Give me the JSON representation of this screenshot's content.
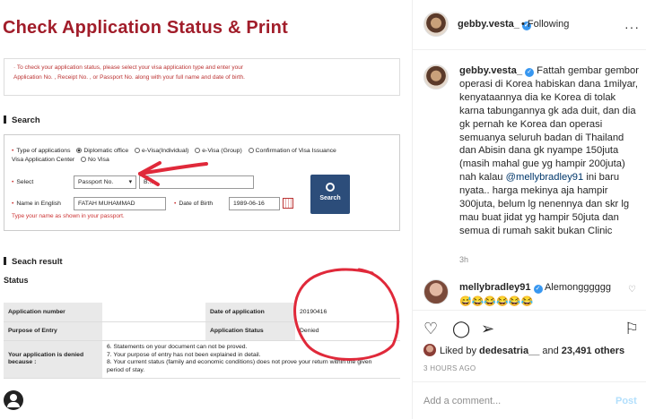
{
  "form": {
    "title": "Check Application Status & Print",
    "instructions": [
      "· To check your application status, please select your visa application type and enter your",
      "Application No. , Receipt No. , or Passport No. along with your full name and date of birth."
    ],
    "search_heading": "Search",
    "type_label": "Type of applications",
    "application_types": [
      {
        "label": "Diplomatic office",
        "selected": true
      },
      {
        "label": "e-Visa(Individual)",
        "selected": false
      },
      {
        "label": "e-Visa (Group)",
        "selected": false
      },
      {
        "label": "Confirmation of Visa Issuance",
        "selected": false
      },
      {
        "label": "Visa Application Center",
        "selected": false
      },
      {
        "label": "No Visa",
        "selected": false
      }
    ],
    "select_label": "Select",
    "select_value": "Passport No.",
    "passport_value": "B...",
    "name_label": "Name in English",
    "name_value": "FATAH MUHAMMAD",
    "dob_label": "Date of Birth",
    "dob_value": "1989-06-16",
    "search_button": "Search",
    "name_hint": "Type your name as shown in your passport.",
    "result_heading": "Seach result",
    "status_label": "Status",
    "rows": {
      "app_number_label": "Application number",
      "date_label": "Date of application",
      "date_value": "20190416",
      "purpose_label": "Purpose of Entry",
      "status_col_label": "Application Status",
      "status_value": "Denied",
      "denied_label": "Your application is denied because :",
      "reasons": [
        "6. Statements on your document can not be proved.",
        "7. Your purpose of entry has not been explained in detail.",
        "8. Your current status (family and economic conditions) does not prove your return within the given",
        "period of stay."
      ]
    }
  },
  "instagram": {
    "author": "gebby.vesta_",
    "following": "Following",
    "caption_user": "gebby.vesta_",
    "caption_text_1": "Fattah gembar gembor operasi di Korea habiskan dana 1milyar, kenyataannya dia ke Korea di tolak karna tabungannya gk ada duit, dan dia gk pernah ke Korea dan operasi semuanya seluruh badan di Thailand dan Abisin dana gk nyampe 150juta (masih mahal gue yg hampir 200juta) nah kalau",
    "caption_mention": "@mellybradley91",
    "caption_text_2": "ini baru nyata.. harga mekinya aja hampir 300juta, belum lg nenennya dan skr lg mau buat jidat yg hampir 50juta dan semua di rumah sakit bukan Clinic",
    "caption_time": "3h",
    "comment_user": "mellybradley91",
    "comment_text": "Alemongggggg",
    "comment_emojis": "😅😂😂😂😂😂",
    "liked_prefix": "Liked by",
    "liked_user": "dedesatria__",
    "liked_and": "and",
    "liked_others": "23,491 others",
    "posted_time": "3 HOURS AGO",
    "add_comment_placeholder": "Add a comment...",
    "post_button": "Post",
    "colors": {
      "link": "#00376b",
      "verified": "#3897f0",
      "post_disabled": "#b2dffc"
    }
  }
}
